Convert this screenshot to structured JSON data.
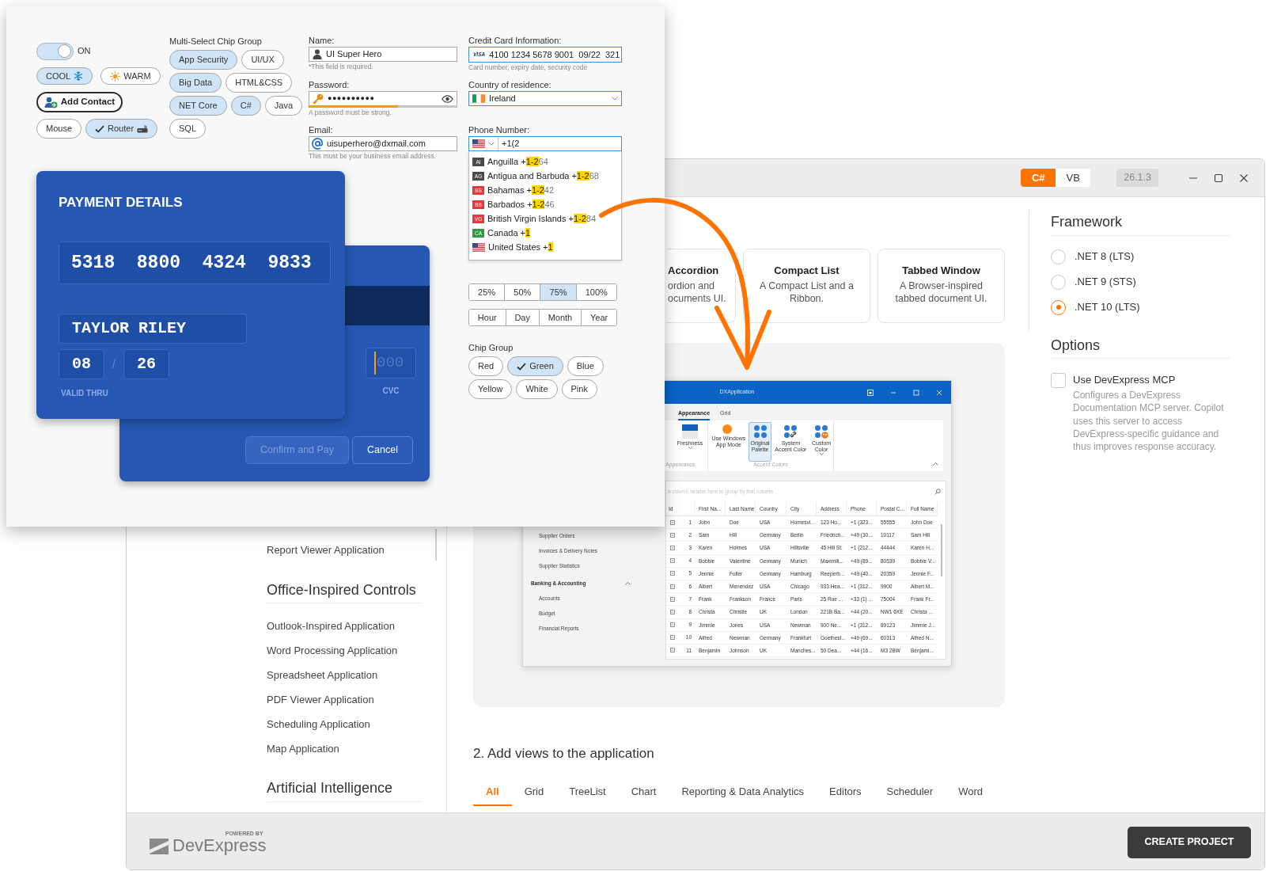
{
  "form_window": {
    "toggle": {
      "label": "ON",
      "on": true
    },
    "weather_chips": [
      {
        "label": "COOL",
        "kind": "snowflake",
        "selected": true
      },
      {
        "label": "WARM",
        "kind": "sun",
        "selected": false
      }
    ],
    "add_contact": "Add Contact",
    "device_chips": [
      {
        "label": "Mouse",
        "kind": "plain",
        "selected": false
      },
      {
        "label": "Router",
        "kind": "router",
        "selected": true
      }
    ],
    "multi_select": {
      "title": "Multi-Select Chip Group",
      "rows": [
        [
          {
            "label": "App Security",
            "selected": true
          },
          {
            "label": "UI/UX",
            "selected": false
          }
        ],
        [
          {
            "label": "Big Data",
            "selected": true
          },
          {
            "label": "HTML&CSS",
            "selected": false
          }
        ],
        [
          {
            "label": "NET Core",
            "selected": true
          },
          {
            "label": "C#",
            "selected": true
          },
          {
            "label": "Java",
            "selected": false
          }
        ],
        [
          {
            "label": "SQL",
            "selected": false
          }
        ]
      ]
    },
    "name": {
      "label": "Name:",
      "value": "UI Super Hero",
      "hint": "*This field is required."
    },
    "password": {
      "label": "Password:",
      "value": "●●●●●●●●●●",
      "level": 0.6,
      "hint": "A password must be strong."
    },
    "email": {
      "label": "Email:",
      "value": "uisuperhero@dxmail.com",
      "hint": "This must be your business email address."
    },
    "credit_card": {
      "label": "Credit Card Information:",
      "brand": "VISA",
      "value": "4100 1234 5678 9001  09/22  321",
      "hint": "Card number, expiry date, security code"
    },
    "country": {
      "label": "Country of residence:",
      "value": "Ireland"
    },
    "phone": {
      "label": "Phone Number:",
      "value": "+1(2",
      "suggestions": [
        {
          "kind": "badge",
          "code": "AI",
          "color": "#4a4a4a",
          "before": "Anguilla +",
          "match": "1-2",
          "after": "64"
        },
        {
          "kind": "badge",
          "code": "AG",
          "color": "#4a4a4a",
          "before": "Antigua and Barbuda +",
          "match": "1-2",
          "after": "68"
        },
        {
          "kind": "badge",
          "code": "BS",
          "color": "#e8383d",
          "before": "Bahamas +",
          "match": "1-2",
          "after": "42"
        },
        {
          "kind": "badge",
          "code": "BB",
          "color": "#e8383d",
          "before": "Barbados +",
          "match": "1-2",
          "after": "46"
        },
        {
          "kind": "badge",
          "code": "VG",
          "color": "#e8383d",
          "before": "British Virgin Islands +",
          "match": "1-2",
          "after": "84"
        },
        {
          "kind": "badge",
          "code": "CA",
          "color": "#2f9a44",
          "before": "Canada +",
          "match": "1"
        },
        {
          "kind": "flag",
          "before": "United States +",
          "match": "1"
        }
      ]
    },
    "zoom_segments": [
      {
        "label": "25%",
        "selected": false
      },
      {
        "label": "50%",
        "selected": false
      },
      {
        "label": "75%",
        "selected": true
      },
      {
        "label": "100%",
        "selected": false
      }
    ],
    "period_segments": [
      {
        "label": "Hour",
        "selected": false
      },
      {
        "label": "Day",
        "selected": false
      },
      {
        "label": "Month",
        "selected": false
      },
      {
        "label": "Year",
        "selected": false
      }
    ],
    "chip_group": {
      "title": "Chip Group",
      "rows": [
        [
          {
            "label": "Red",
            "selected": false
          },
          {
            "label": "Green",
            "selected": true
          },
          {
            "label": "Blue",
            "selected": false
          }
        ],
        [
          {
            "label": "Yellow",
            "selected": false
          },
          {
            "label": "White",
            "selected": false
          },
          {
            "label": "Pink",
            "selected": false
          }
        ]
      ]
    },
    "payment": {
      "title": "PAYMENT DETAILS",
      "card_number": "5318  8800  4324  9833",
      "holder": "TAYLOR RILEY",
      "month": "08",
      "separator": "/",
      "year": "26",
      "valid_label": "VALID THRU",
      "cvc_placeholder": "000",
      "cvc_label": "CVC",
      "buttons": [
        {
          "label": "Confirm and Pay",
          "disabled": true
        },
        {
          "label": "Cancel",
          "disabled": false
        }
      ]
    }
  },
  "app_window": {
    "languages": [
      {
        "label": "C#",
        "selected": true
      },
      {
        "label": "VB",
        "selected": false
      }
    ],
    "version": "26.1.3",
    "nav": {
      "items": [
        "Report Viewer Application"
      ],
      "sections": [
        {
          "title": "Office-Inspired Controls",
          "items": [
            "Outlook-Inspired Application",
            "Word Processing Application",
            "Spreadsheet Application",
            "PDF Viewer Application",
            "Scheduling Application",
            "Map Application"
          ]
        },
        {
          "title": "Artificial Intelligence"
        }
      ]
    },
    "templates": [
      {
        "kind": "partial",
        "title": "Accordion",
        "description": "ordion and ocuments UI."
      },
      {
        "kind": "full",
        "title": "Compact List",
        "description": "A Compact List and a Ribbon."
      },
      {
        "kind": "full",
        "title": "Tabbed Window",
        "description": "A Browser-inspired tabbed document UI."
      }
    ],
    "preview": {
      "title": "DXApplication",
      "tabs": [
        {
          "label": "Appearance",
          "selected": true
        },
        {
          "label": "Grid",
          "selected": false
        }
      ],
      "ribbon_groups": [
        {
          "label": "Appearance",
          "items": [
            {
              "label": "Freshness",
              "kind": "skin",
              "dropdown": true,
              "selected": false
            }
          ]
        },
        {
          "label": "Accent Colors",
          "items": [
            {
              "label": "Use Windows App Mode",
              "kind": "mode",
              "dropdown": false,
              "selected": false
            },
            {
              "label": "Original Palette",
              "kind": "palette",
              "dropdown": false,
              "selected": true
            },
            {
              "label": "System Accent Color",
              "kind": "accent",
              "dropdown": false,
              "selected": false
            },
            {
              "label": "Custom Color",
              "kind": "custom",
              "dropdown": true,
              "selected": false
            }
          ]
        }
      ],
      "nav_items": [
        "Supplier Orders",
        "Invoices & Delivery Notes",
        "Supplier Statistics"
      ],
      "nav_group": {
        "label": "Banking & Accounting",
        "expanded": true,
        "items": [
          "Accounts",
          "Budget",
          "Financial Reports"
        ]
      },
      "group_hint": "a column header here to group by that column",
      "columns": [
        "Id",
        "First Na...",
        "Last Name",
        "Country",
        "City",
        "Address",
        "Phone",
        "Postal C...",
        "Full Name"
      ],
      "rows": [
        [
          "1",
          "John",
          "Doe",
          "USA",
          "Homesvi...",
          "123 Ho...",
          "+1 (323...",
          "55555",
          "John Doe"
        ],
        [
          "2",
          "Sam",
          "Hill",
          "Germany",
          "Berlin",
          "Friedrich...",
          "+49 (30...",
          "10117",
          "Sam Hill"
        ],
        [
          "3",
          "Karen",
          "Holmes",
          "USA",
          "Hillsville",
          "45 Hill St.",
          "+1 (212...",
          "44444",
          "Karen H..."
        ],
        [
          "4",
          "Bobbie",
          "Valentine",
          "Germany",
          "Munich",
          "Maximili...",
          "+49 (89...",
          "80539",
          "Bobbie V..."
        ],
        [
          "5",
          "Jennie",
          "Fuller",
          "Germany",
          "Hamburg",
          "Reeperb...",
          "+49 (40...",
          "20359",
          "Jennie F..."
        ],
        [
          "6",
          "Albert",
          "Menendez",
          "USA",
          "Chicago",
          "933 Hea...",
          "+1 (312...",
          "9900",
          "Albert M..."
        ],
        [
          "7",
          "Frank",
          "Frankson",
          "France",
          "Paris",
          "25 Rue ...",
          "+33 (1) ...",
          "75004",
          "Frank Fr..."
        ],
        [
          "8",
          "Christa",
          "Christie",
          "UK",
          "London",
          "221B Ba...",
          "+44 (20...",
          "NW1 6XE",
          "Christa ..."
        ],
        [
          "9",
          "Jimmie",
          "Jones",
          "USA",
          "Newman",
          "900 Ne...",
          "+1 (312...",
          "89123",
          "Jimmie J..."
        ],
        [
          "10",
          "Alfred",
          "Newman",
          "Germany",
          "Frankfurt",
          "Goethest...",
          "+49 (69...",
          "60313",
          "Alfred N..."
        ],
        [
          "11",
          "Benjamin",
          "Johnson",
          "UK",
          "Manches...",
          "50 Dea...",
          "+44 (16...",
          "M3 2BW",
          "Benjami..."
        ]
      ]
    },
    "section_title": "2. Add views to the application",
    "view_tabs": [
      {
        "label": "All",
        "selected": true
      },
      {
        "label": "Grid",
        "selected": false
      },
      {
        "label": "TreeList",
        "selected": false
      },
      {
        "label": "Chart",
        "selected": false
      },
      {
        "label": "Reporting & Data Analytics",
        "selected": false
      },
      {
        "label": "Editors",
        "selected": false
      },
      {
        "label": "Scheduler",
        "selected": false
      },
      {
        "label": "Word",
        "selected": false
      }
    ],
    "framework": {
      "title": "Framework",
      "options": [
        {
          "label": ".NET 8 (LTS)",
          "selected": false
        },
        {
          "label": ".NET 9 (STS)",
          "selected": false
        },
        {
          "label": ".NET 10 (LTS)",
          "selected": true
        }
      ]
    },
    "options": {
      "title": "Options",
      "items": [
        {
          "label": "Use DevExpress MCP",
          "checked": false,
          "description": "Configures a DevExpress Documentation MCP server. Copilot uses this server to access DevExpress-specific guidance and thus improves response accuracy."
        }
      ]
    },
    "footer": {
      "tagline": "POWERED BY",
      "brand": "DevExpress",
      "button": "CREATE PROJECT"
    }
  }
}
